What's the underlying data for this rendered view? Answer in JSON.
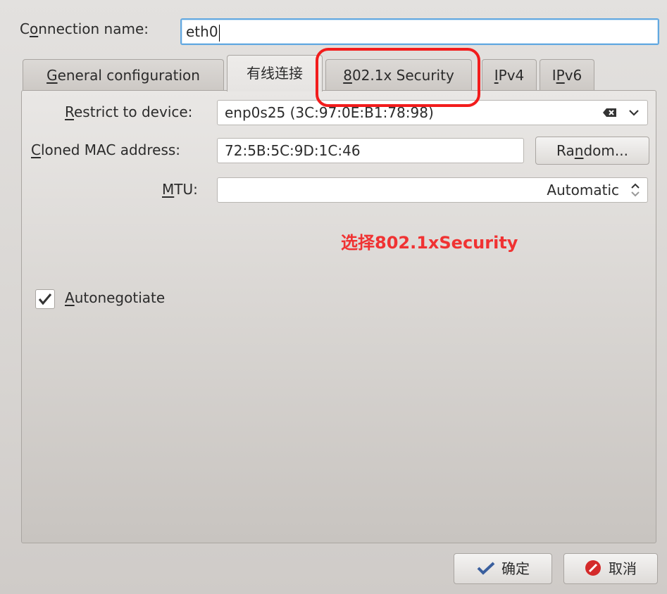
{
  "connection": {
    "label_prefix": "C",
    "label_u": "o",
    "label_rest": "nnection name:",
    "value": "eth0"
  },
  "tabs": [
    {
      "label": "General configuration",
      "u": "G",
      "rest": "eneral configuration"
    },
    {
      "label": "有线连接"
    },
    {
      "label": "802.1x Security",
      "u": "8",
      "rest": "02.1x Security"
    },
    {
      "label": "IPv4",
      "u": "I",
      "rest": "Pv4"
    },
    {
      "label": "IPv6",
      "pre": "I",
      "u": "P",
      "rest": "v6"
    }
  ],
  "wired": {
    "restrict": {
      "u": "R",
      "rest": "estrict to device:",
      "value": "enp0s25 (3C:97:0E:B1:78:98)"
    },
    "cloned": {
      "u": "C",
      "rest": "loned MAC address:",
      "value": "72:5B:5C:9D:1C:46"
    },
    "random_button": {
      "pre": "Ra",
      "u": "n",
      "rest": "dom..."
    },
    "mtu": {
      "u": "M",
      "rest": "TU:",
      "value": "Automatic"
    },
    "autoneg": {
      "u": "A",
      "rest": "utonegotiate",
      "checked": true
    }
  },
  "annotation": "选择802.1xSecurity",
  "annotation_color": "#f03232",
  "buttons": {
    "ok": "确定",
    "cancel": "取消"
  },
  "icons": {
    "ok": "checkmark-icon",
    "cancel": "cancel-icon",
    "clear": "clear-field-icon",
    "dropdown": "chevron-down-icon",
    "spin": "spin-arrows-icon"
  }
}
